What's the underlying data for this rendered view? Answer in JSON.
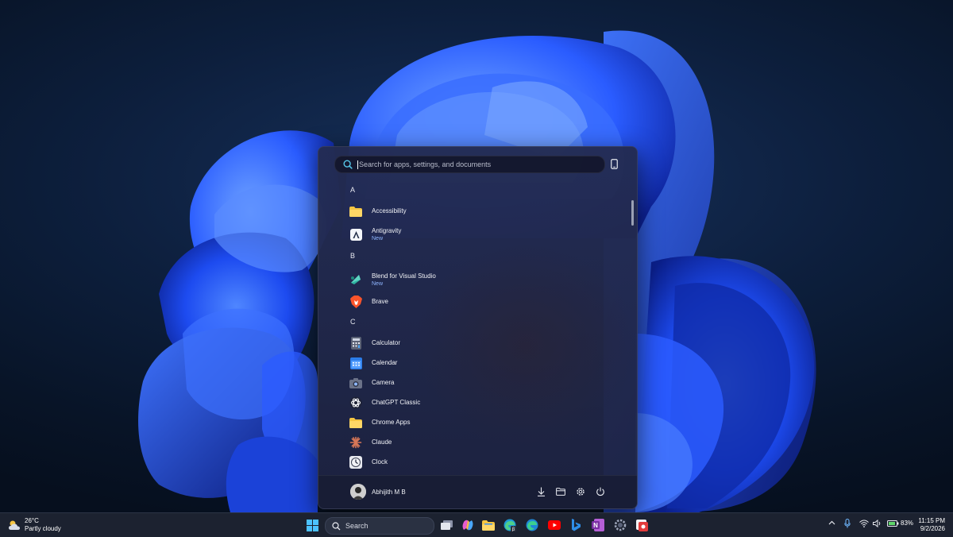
{
  "search": {
    "placeholder": "Search for apps, settings, and documents"
  },
  "apps": {
    "group_a": "A",
    "group_b": "B",
    "group_c": "C",
    "accessibility": "Accessibility",
    "antigravity": "Antigravity",
    "antigravity_badge": "New",
    "blend": "Blend for Visual Studio",
    "blend_badge": "New",
    "brave": "Brave",
    "calculator": "Calculator",
    "calendar": "Calendar",
    "camera": "Camera",
    "chatgpt": "ChatGPT Classic",
    "chrome_apps": "Chrome Apps",
    "claude": "Claude",
    "clock": "Clock"
  },
  "user": {
    "name": "Abhijith M B"
  },
  "weather": {
    "temp": "26°C",
    "condition": "Partly cloudy"
  },
  "taskbar": {
    "search_label": "Search"
  },
  "tray": {
    "battery": "83%"
  },
  "clock": {
    "time": "11:15 PM",
    "date": "9/2/2026"
  },
  "colors": {
    "accent": "#8fb6ff",
    "wallpaper_blue": "#1f4fff",
    "folder": "#f5c542"
  }
}
